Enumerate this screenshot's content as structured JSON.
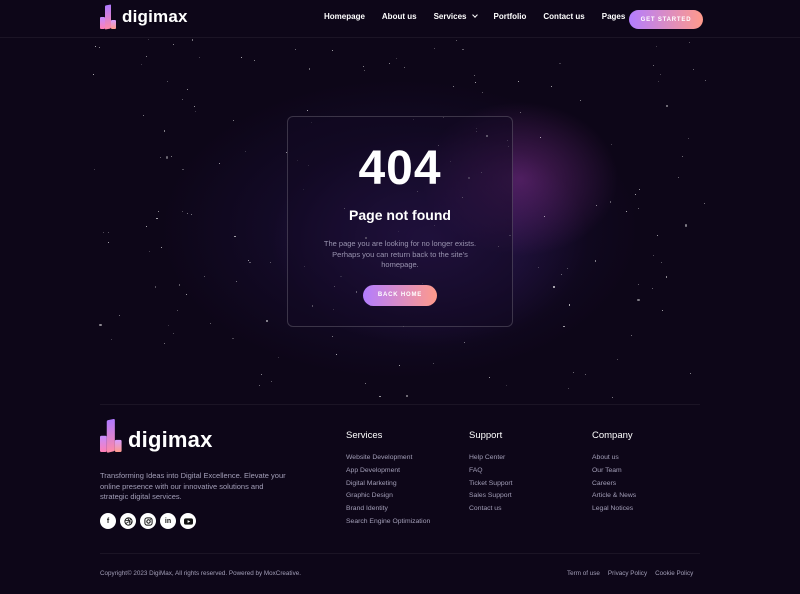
{
  "brand": {
    "name": "digimax"
  },
  "nav": {
    "items": [
      {
        "label": "Homepage",
        "dropdown": false
      },
      {
        "label": "About us",
        "dropdown": false
      },
      {
        "label": "Services",
        "dropdown": true
      },
      {
        "label": "Portfolio",
        "dropdown": false
      },
      {
        "label": "Contact us",
        "dropdown": false
      },
      {
        "label": "Pages",
        "dropdown": true
      }
    ],
    "cta": "GET STARTED"
  },
  "error": {
    "code": "404",
    "title": "Page not found",
    "message": "The page you are looking for no longer exists. Perhaps you can return back to the site's homepage.",
    "button": "BACK HOME"
  },
  "footer": {
    "tagline": "Transforming Ideas into Digital Excellence. Elevate your online presence with our innovative solutions and strategic digital services.",
    "socials": [
      "facebook-icon",
      "dribbble-icon",
      "instagram-icon",
      "linkedin-icon",
      "youtube-icon"
    ],
    "columns": {
      "services": {
        "title": "Services",
        "links": [
          "Website Development",
          "App Development",
          "Digital Marketing",
          "Graphic Design",
          "Brand Identity",
          "Search Engine Optimization"
        ]
      },
      "support": {
        "title": "Support",
        "links": [
          "Help Center",
          "FAQ",
          "Ticket Support",
          "Sales Support",
          "Contact us"
        ]
      },
      "company": {
        "title": "Company",
        "links": [
          "About us",
          "Our Team",
          "Careers",
          "Article & News",
          "Legal Notices"
        ]
      }
    },
    "copyright": "Copyright© 2023 DigiMax, All rights reserved. Powered by MoxCreative.",
    "legal": [
      "Term of use",
      "Privacy Policy",
      "Cookie Policy"
    ]
  },
  "colors": {
    "background": "#0d0618",
    "gradient_start": "#b37dff",
    "gradient_end": "#ff9a8b",
    "muted_text": "#a39fb8"
  }
}
